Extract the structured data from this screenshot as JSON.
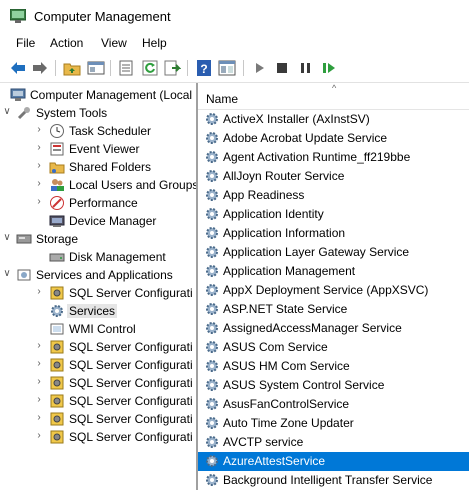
{
  "window": {
    "title": "Computer Management"
  },
  "menu": [
    "File",
    "Action",
    "View",
    "Help"
  ],
  "toolbar": {
    "buttons": [
      "back-icon",
      "forward-icon",
      "up-folder-icon",
      "show-hide-tree-icon",
      "properties-icon",
      "refresh-icon",
      "export-list-icon",
      "help-icon",
      "view-icon",
      "start-icon",
      "stop-icon",
      "pause-icon",
      "resume-icon"
    ]
  },
  "tree": [
    {
      "label": "Computer Management (Local",
      "icon": "computer-management-icon",
      "level": 0,
      "arrow": ""
    },
    {
      "label": "System Tools",
      "icon": "tools-icon",
      "level": 1,
      "arrow": "expanded"
    },
    {
      "label": "Task Scheduler",
      "icon": "clock-icon",
      "level": 2,
      "arrow": "collapsed"
    },
    {
      "label": "Event Viewer",
      "icon": "event-viewer-icon",
      "level": 2,
      "arrow": "collapsed"
    },
    {
      "label": "Shared Folders",
      "icon": "shared-folder-icon",
      "level": 2,
      "arrow": "collapsed"
    },
    {
      "label": "Local Users and Groups",
      "icon": "users-icon",
      "level": 2,
      "arrow": "collapsed"
    },
    {
      "label": "Performance",
      "icon": "performance-icon",
      "level": 2,
      "arrow": "collapsed"
    },
    {
      "label": "Device Manager",
      "icon": "device-manager-icon",
      "level": 2,
      "arrow": ""
    },
    {
      "label": "Storage",
      "icon": "storage-icon",
      "level": 1,
      "arrow": "expanded"
    },
    {
      "label": "Disk Management",
      "icon": "disk-icon",
      "level": 2,
      "arrow": ""
    },
    {
      "label": "Services and Applications",
      "icon": "services-apps-icon",
      "level": 1,
      "arrow": "expanded"
    },
    {
      "label": "SQL Server Configurati",
      "icon": "sql-config-icon",
      "level": 2,
      "arrow": "collapsed"
    },
    {
      "label": "Services",
      "icon": "gear-icon",
      "level": 2,
      "arrow": "",
      "selected": true
    },
    {
      "label": "WMI Control",
      "icon": "wmi-icon",
      "level": 2,
      "arrow": ""
    },
    {
      "label": "SQL Server Configurati",
      "icon": "sql-config-icon",
      "level": 2,
      "arrow": "collapsed"
    },
    {
      "label": "SQL Server Configurati",
      "icon": "sql-config-icon",
      "level": 2,
      "arrow": "collapsed"
    },
    {
      "label": "SQL Server Configurati",
      "icon": "sql-config-icon",
      "level": 2,
      "arrow": "collapsed"
    },
    {
      "label": "SQL Server Configurati",
      "icon": "sql-config-icon",
      "level": 2,
      "arrow": "collapsed"
    },
    {
      "label": "SQL Server Configurati",
      "icon": "sql-config-icon",
      "level": 2,
      "arrow": "collapsed"
    },
    {
      "label": "SQL Server Configurati",
      "icon": "sql-config-icon",
      "level": 2,
      "arrow": "collapsed"
    }
  ],
  "services": {
    "column_name": "Name",
    "items": [
      "ActiveX Installer (AxInstSV)",
      "Adobe Acrobat Update Service",
      "Agent Activation Runtime_ff219bbe",
      "AllJoyn Router Service",
      "App Readiness",
      "Application Identity",
      "Application Information",
      "Application Layer Gateway Service",
      "Application Management",
      "AppX Deployment Service (AppXSVC)",
      "ASP.NET State Service",
      "AssignedAccessManager Service",
      "ASUS Com Service",
      "ASUS HM Com Service",
      "ASUS System Control Service",
      "AsusFanControlService",
      "Auto Time Zone Updater",
      "AVCTP service",
      "AzureAttestService",
      "Background Intelligent Transfer Service"
    ],
    "selected_index": 18
  },
  "colors": {
    "selection": "#0078d7",
    "titlebar_icon": "#2e7d32"
  }
}
